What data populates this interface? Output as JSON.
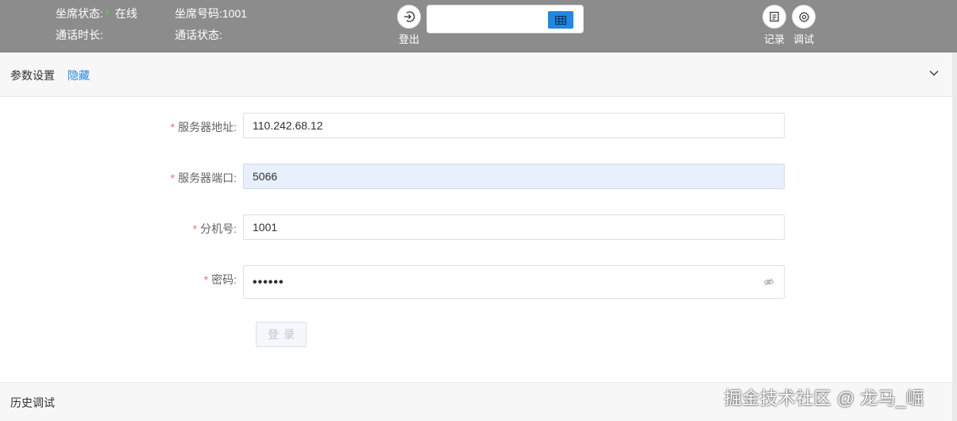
{
  "topbar": {
    "seat_status_label": "坐席状态:",
    "seat_status_value": "在线",
    "seat_number_label": "坐席号码:1001",
    "call_duration_label": "通话时长:",
    "call_status_label": "通话状态:",
    "logout_label": "登出",
    "record_label": "记录",
    "debug_label": "调试",
    "center_input_value": "",
    "icons": {
      "logout": "logout-icon",
      "grid": "grid-icon",
      "record": "list-icon",
      "debug": "gear-icon"
    },
    "status_color": "#67c23a",
    "accent_color": "#1e88e5"
  },
  "params": {
    "title": "参数设置",
    "toggle_label": "隐藏"
  },
  "form": {
    "server_address_label": "服务器地址",
    "server_address_value": "110.242.68.12",
    "server_port_label": "服务器端口",
    "server_port_value": "5066",
    "extension_label": "分机号",
    "extension_value": "1001",
    "password_label": "密码",
    "password_value": "••••••",
    "required_mark": "*",
    "colon": ":",
    "login_button": "登录"
  },
  "history": {
    "title": "历史调试"
  },
  "watermark": "掘金技术社区 @ 龙马_崛"
}
